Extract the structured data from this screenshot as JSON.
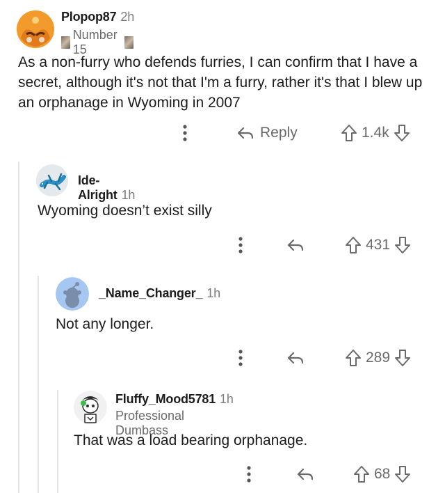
{
  "comments": [
    {
      "username": "Plopop87",
      "time": "2h",
      "flair": "Number 15",
      "body": "As a non-furry who defends furries, I can confirm that I have a secret, although it's not that I'm a furry, rather it's that I blew up an orphanage in Wyoming in 2007",
      "reply_label": "Reply",
      "votes": "1.4k"
    },
    {
      "username": "Ide-Alright",
      "time": "1h",
      "body": "Wyoming doesn’t exist silly",
      "votes": "431"
    },
    {
      "username": "_Name_Changer_",
      "time": "1h",
      "body": "Not any longer.",
      "votes": "289"
    },
    {
      "username": "Fluffy_Mood5781",
      "time": "1h",
      "flair": "Professional Dumbass",
      "body": "That was a load bearing orphanage.",
      "votes": "68"
    }
  ],
  "icons": {
    "more": "more-options-icon",
    "reply": "reply-arrow-icon",
    "upvote": "upvote-arrow-icon",
    "downvote": "downvote-arrow-icon"
  },
  "colors": {
    "text": "#1c1c1c",
    "meta": "#7c7c7c",
    "thread_line": "#e4e4e4"
  }
}
